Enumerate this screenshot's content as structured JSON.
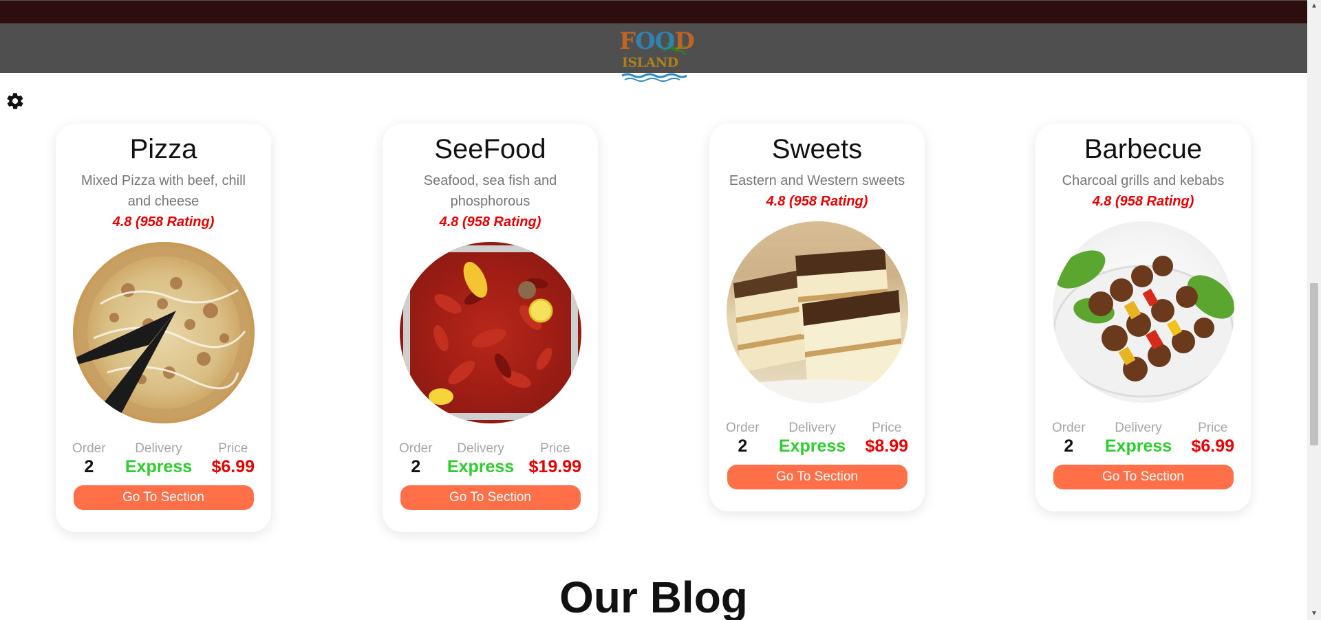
{
  "header": {
    "logo_line1": "F",
    "logo_oo": "OO",
    "logo_d": "D",
    "logo_line2": "ISLAND"
  },
  "settings": {
    "icon": "gear-icon"
  },
  "labels": {
    "order": "Order",
    "delivery": "Delivery",
    "price": "Price",
    "button": "Go To Section"
  },
  "cards": [
    {
      "title": "Pizza",
      "description": "Mixed Pizza with beef, chill and cheese",
      "rating": "4.8 (958 Rating)",
      "order": "2",
      "delivery": "Express",
      "price": "$6.99"
    },
    {
      "title": "SeeFood",
      "description": "Seafood, sea fish and phosphorous",
      "rating": "4.8 (958 Rating)",
      "order": "2",
      "delivery": "Express",
      "price": "$19.99"
    },
    {
      "title": "Sweets",
      "description": "Eastern and Western sweets",
      "rating": "4.8 (958 Rating)",
      "order": "2",
      "delivery": "Express",
      "price": "$8.99"
    },
    {
      "title": "Barbecue",
      "description": "Charcoal grills and kebabs",
      "rating": "4.8 (958 Rating)",
      "order": "2",
      "delivery": "Express",
      "price": "$6.99"
    }
  ],
  "blog": {
    "title": "Our Blog"
  },
  "colors": {
    "topbar": "#2e0d0e",
    "navband": "#4f4f4f",
    "button": "#ff7048",
    "rating": "#e60000",
    "delivery": "#2ecc2e",
    "price": "#e60000"
  }
}
